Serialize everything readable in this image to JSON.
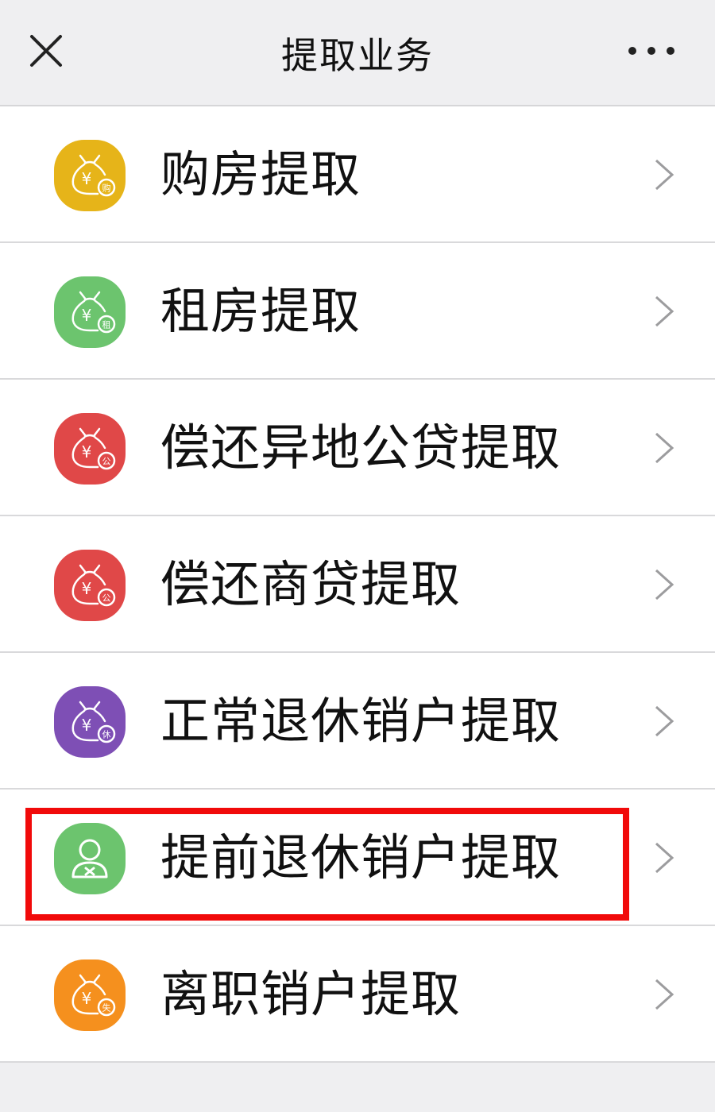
{
  "header": {
    "title": "提取业务"
  },
  "items": [
    {
      "label": "购房提取",
      "badge": "购",
      "icon": "money-bag-icon",
      "color": "#e6b419"
    },
    {
      "label": "租房提取",
      "badge": "租",
      "icon": "money-bag-icon",
      "color": "#6cc46e"
    },
    {
      "label": "偿还异地公贷提取",
      "badge": "公",
      "icon": "money-bag-icon",
      "color": "#e04848"
    },
    {
      "label": "偿还商贷提取",
      "badge": "公",
      "icon": "money-bag-icon",
      "color": "#e04848"
    },
    {
      "label": "正常退休销户提取",
      "badge": "休",
      "icon": "money-bag-icon",
      "color": "#7e4fb5"
    },
    {
      "label": "提前退休销户提取",
      "badge": "",
      "icon": "user-x-icon",
      "color": "#6cc46e"
    },
    {
      "label": "离职销户提取",
      "badge": "失",
      "icon": "money-bag-icon",
      "color": "#f5901e"
    }
  ],
  "colors": {
    "highlight": "#f10a0a",
    "background": "#efeff1"
  }
}
